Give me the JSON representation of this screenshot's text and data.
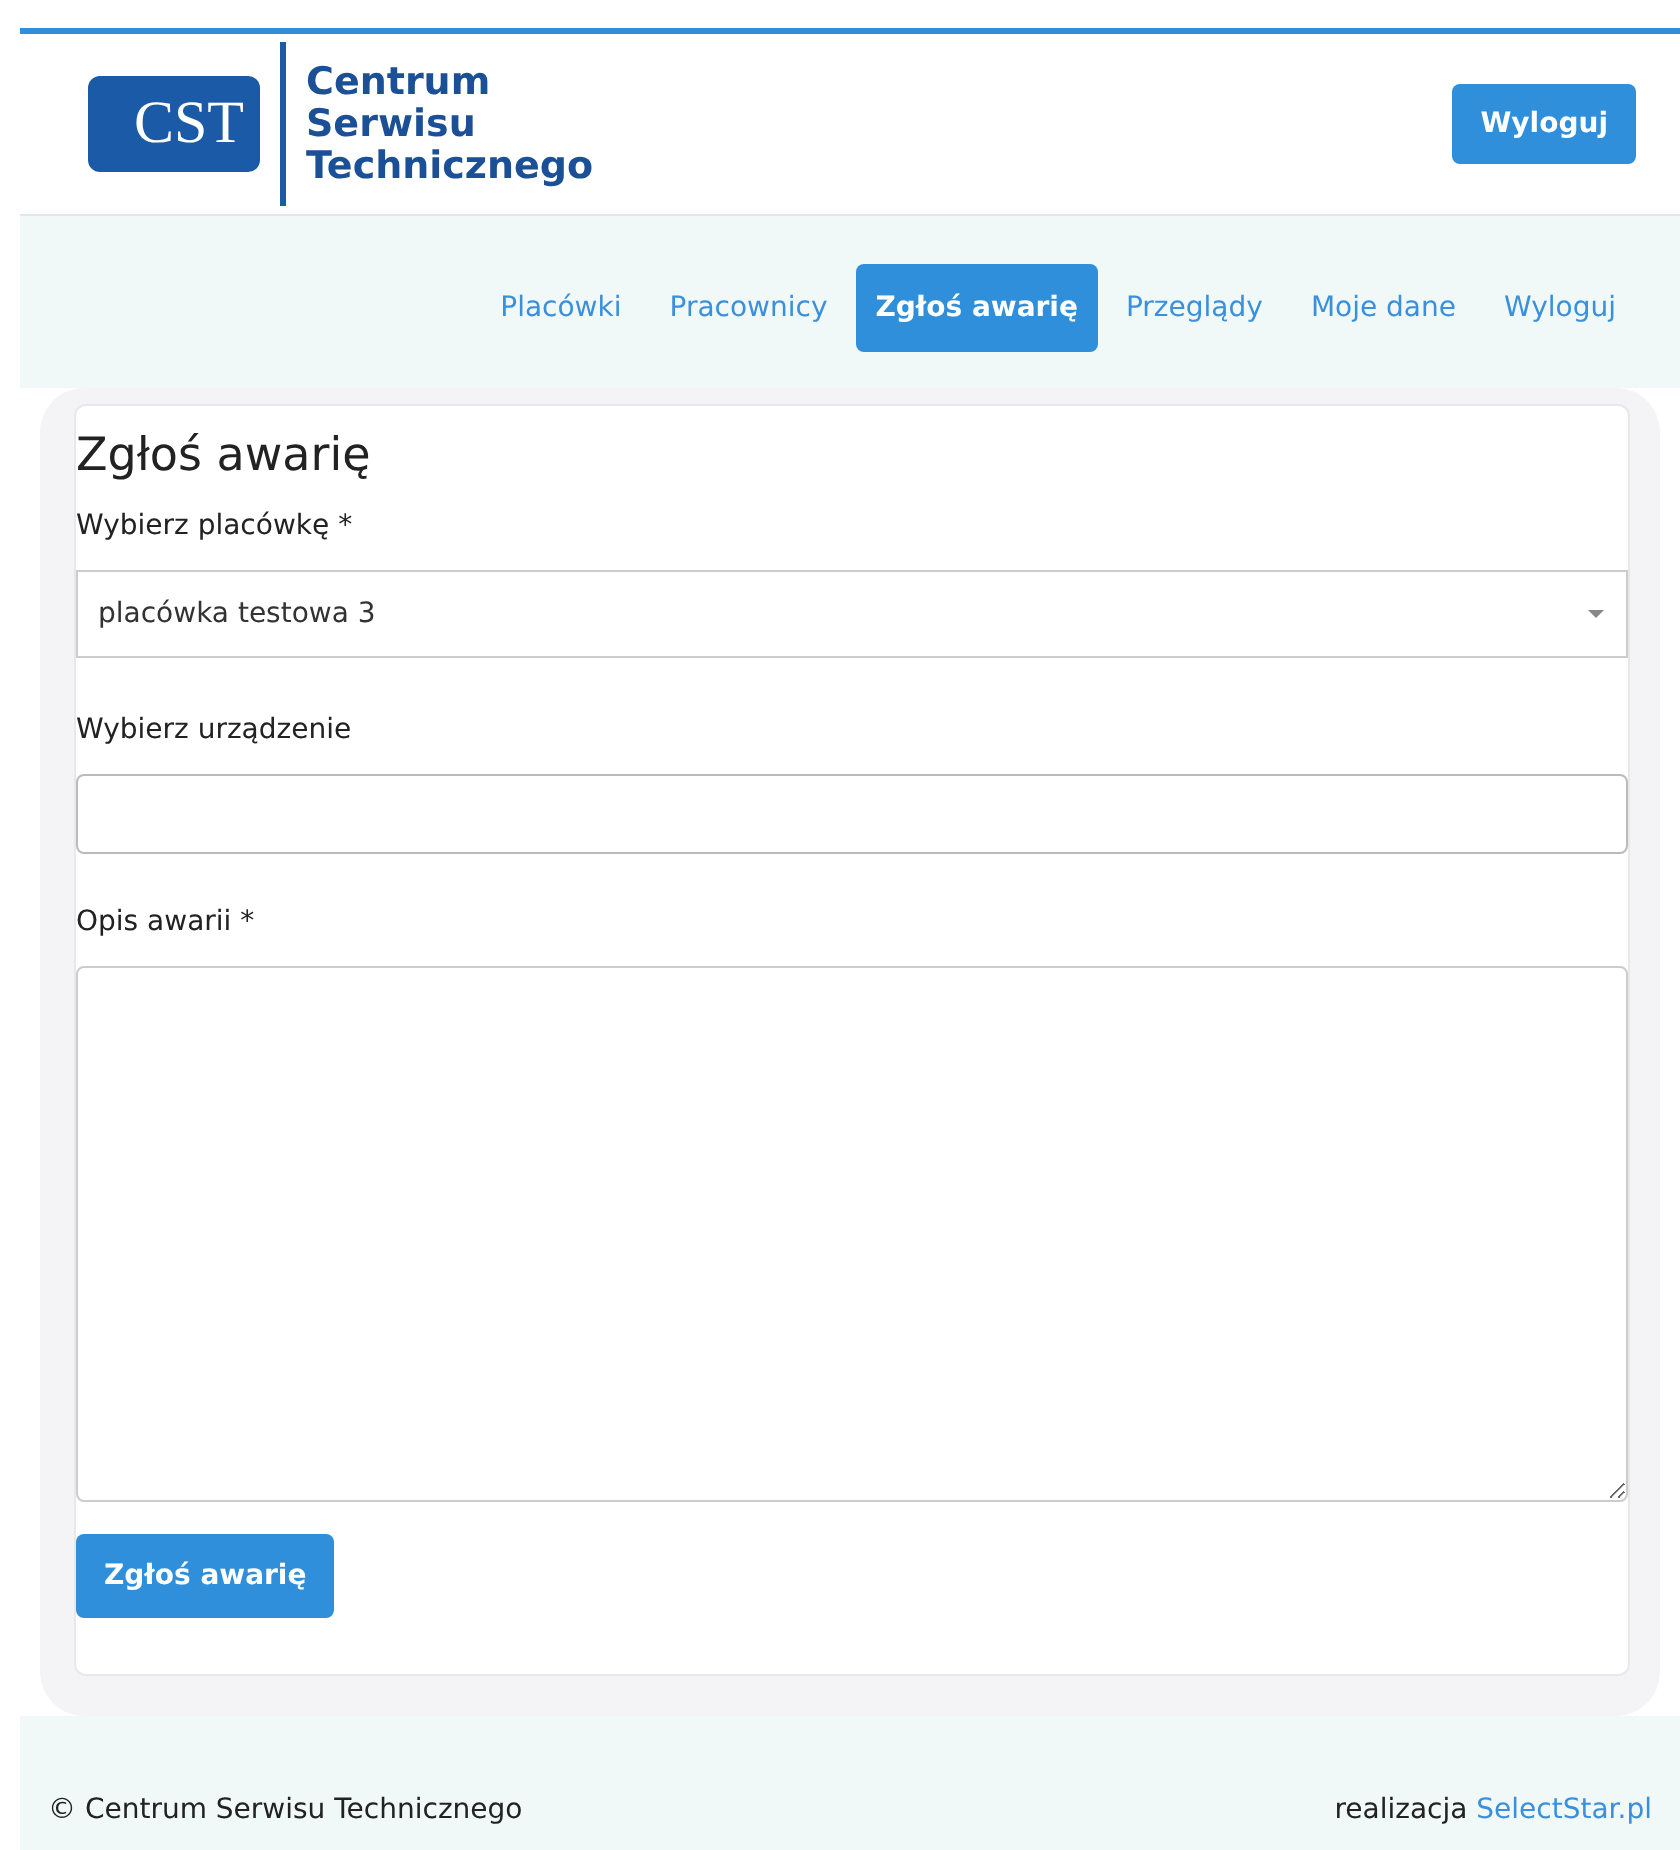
{
  "header": {
    "logo_mark": "CST",
    "logo_lines": [
      "Centrum",
      "Serwisu",
      "Technicznego"
    ],
    "logout_button": "Wyloguj"
  },
  "nav": [
    {
      "label": "Placówki",
      "selected": false
    },
    {
      "label": "Pracownicy",
      "selected": false
    },
    {
      "label": "Zgłoś awarię",
      "selected": true
    },
    {
      "label": "Przeglądy",
      "selected": false
    },
    {
      "label": "Moje dane",
      "selected": false
    },
    {
      "label": "Wyloguj",
      "selected": false
    }
  ],
  "form": {
    "title": "Zgłoś awarię",
    "fields": [
      {
        "kind": "select",
        "label": "Wybierz placówkę *",
        "value": "placówka testowa 3"
      },
      {
        "kind": "input",
        "label": "Wybierz urządzenie"
      },
      {
        "kind": "textarea",
        "label": "Opis awarii *"
      }
    ],
    "submit": "Zgłoś awarię"
  },
  "footer": {
    "copyright": "© Centrum Serwisu Technicznego",
    "credit": "realizacja",
    "credit_link": "SelectStar.pl"
  }
}
